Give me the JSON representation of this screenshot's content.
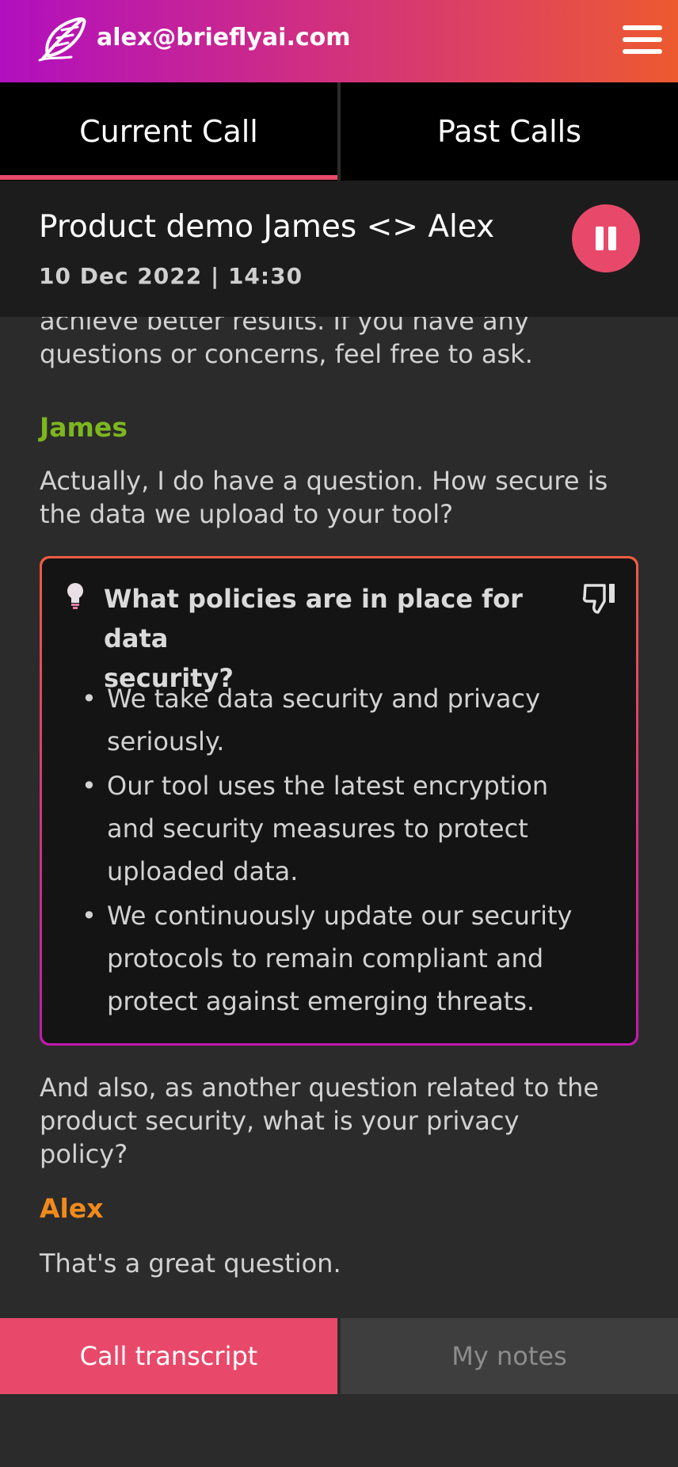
{
  "header": {
    "email": "alex@brieflyai.com",
    "gradient_colors": [
      "#b10fbf",
      "#ed5a2f"
    ]
  },
  "tabs": {
    "current": "Current Call",
    "past": "Past Calls"
  },
  "call": {
    "title": "Product demo James <> Alex",
    "date": "10 Dec 2022 | 14:30"
  },
  "transcript": {
    "partial_line_1": "achieve better results. If you have any",
    "partial_line_2": "questions or concerns, feel free to ask.",
    "james_label": "James",
    "james_text_1": "Actually, I do have a question. How secure is",
    "james_text_2": "the data we upload to your tool?",
    "card": {
      "title_1": "What policies are in place for data",
      "title_2": "security?",
      "bullets": [
        [
          "We take data security and privacy",
          "seriously."
        ],
        [
          "Our tool uses the latest encryption",
          "and security measures to protect",
          "uploaded data."
        ],
        [
          "We continuously update our security",
          "protocols to remain compliant and",
          "protect against emerging threats."
        ]
      ]
    },
    "followup_1": "And also, as another question related to the",
    "followup_2": "product security, what is your privacy",
    "followup_3": "policy?",
    "alex_label": "Alex",
    "alex_text": "That's a great question."
  },
  "bottom_tabs": {
    "transcript": "Call transcript",
    "notes": "My notes"
  },
  "colors": {
    "accent": "#e8496a",
    "james": "#7db61f",
    "alex": "#f08a1c"
  },
  "icons": {
    "logo": "feather-logo-icon",
    "menu": "hamburger-menu-icon",
    "pause": "pause-icon",
    "suggestion": "lightbulb-icon",
    "feedback": "thumbs-down-icon"
  }
}
